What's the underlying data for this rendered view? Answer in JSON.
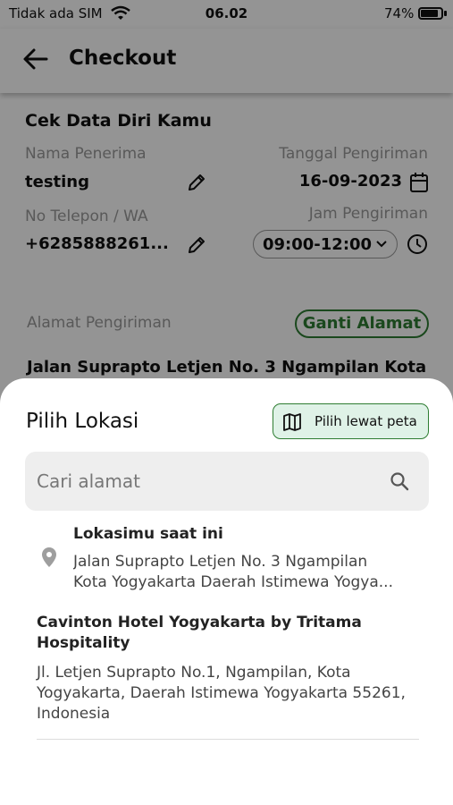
{
  "status_bar": {
    "carrier": "Tidak ada SIM",
    "time": "06.02",
    "battery": "74%"
  },
  "app_bar": {
    "title": "Checkout"
  },
  "personal": {
    "section_title": "Cek Data Diri Kamu",
    "recipient_label": "Nama Penerima",
    "recipient_value": "testing",
    "date_label": "Tanggal Pengiriman",
    "date_value": "16-09-2023",
    "phone_label": "No Telepon / WA",
    "phone_value": "+6285888261...",
    "time_label": "Jam Pengiriman",
    "time_value": "09:00-12:00"
  },
  "address": {
    "label": "Alamat Pengiriman",
    "change_button": "Ganti Alamat",
    "value": "Jalan Suprapto Letjen No. 3 Ngampilan Kota"
  },
  "sheet": {
    "title": "Pilih Lokasi",
    "map_button": "Pilih lewat peta",
    "search_placeholder": "Cari alamat",
    "current_location": {
      "title": "Lokasimu saat ini",
      "line1": "Jalan Suprapto Letjen No. 3 Ngampilan",
      "line2": "Kota Yogyakarta  Daerah Istimewa Yogya..."
    },
    "results": [
      {
        "name": "Cavinton Hotel Yogyakarta by Tritama Hospitality",
        "address": "Jl. Letjen Suprapto No.1, Ngampilan, Kota Yogyakarta, Daerah Istimewa Yogyakarta 55261, Indonesia"
      }
    ]
  },
  "colors": {
    "accent_green": "#2e7d32",
    "map_button_bg": "#dff2e7",
    "search_bg": "#eeeeee"
  }
}
